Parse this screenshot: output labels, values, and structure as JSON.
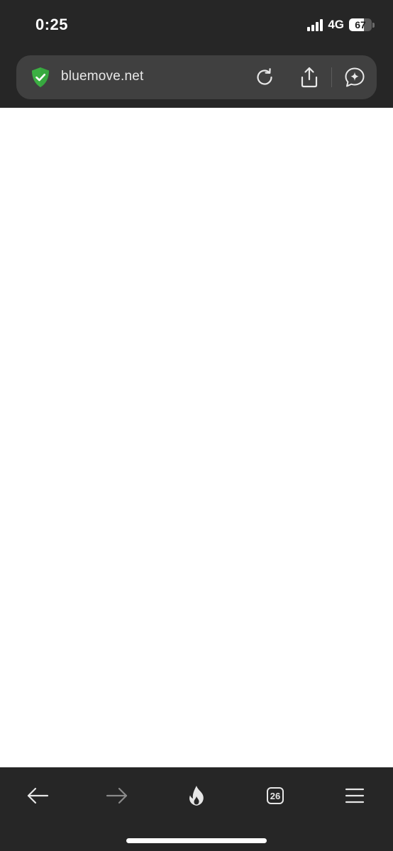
{
  "status_bar": {
    "time": "0:25",
    "network": "4G",
    "battery_level": "67",
    "battery_fraction": 0.67,
    "signal_bars": 4
  },
  "address_bar": {
    "url": "bluemove.net",
    "security_icon": "shield-check-icon",
    "buttons": {
      "reload": "reload-icon",
      "share": "share-icon",
      "assistant": "ai-chat-sparkle-icon"
    }
  },
  "toolbar": {
    "back": "arrow-left-icon",
    "forward": "arrow-right-icon",
    "hot": "flame-icon",
    "tabs_count": "26",
    "menu": "hamburger-menu-icon"
  },
  "colors": {
    "chrome_background": "#262626",
    "address_bar_background": "#404040",
    "shield_green": "#3cb043",
    "content_background": "#ffffff",
    "forward_disabled": "#8a8a8a"
  }
}
